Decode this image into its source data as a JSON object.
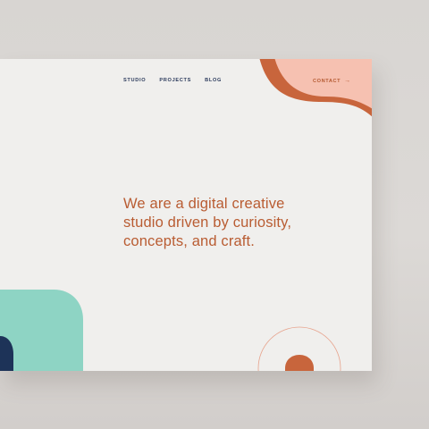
{
  "nav": {
    "items": [
      {
        "label": "STUDIO"
      },
      {
        "label": "PROJECTS"
      },
      {
        "label": "BLOG"
      }
    ],
    "contact_label": "CONTACT",
    "contact_icon": "arrow-right-icon"
  },
  "hero": {
    "lines": [
      "We are a digital creative",
      "studio driven by curiosity,",
      "concepts, and craft."
    ]
  },
  "colors": {
    "background": "#f0efed",
    "peach": "#f6c1b1",
    "terracotta": "#c8653c",
    "mint": "#8ed4c4",
    "navy": "#1d3358",
    "nav_text": "#2b3a5c",
    "accent_text": "#b95c32"
  }
}
